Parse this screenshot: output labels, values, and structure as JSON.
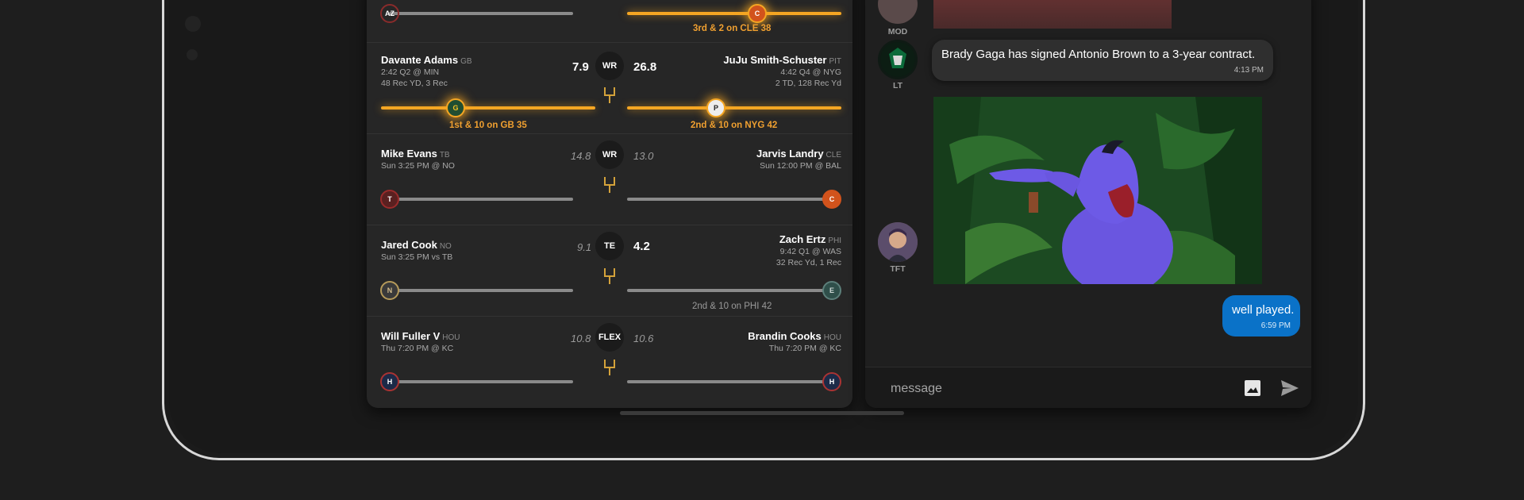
{
  "matchups": [
    {
      "left": {
        "name": "",
        "team": "",
        "meta1": "",
        "meta2": "",
        "points": "",
        "team_icon": "cardinals-helmet-icon"
      },
      "position": "",
      "right": {
        "name": "",
        "team": "",
        "meta1": "",
        "meta2": "",
        "points": "",
        "team_icon": "browns-helmet-icon"
      },
      "right_status": "3rd & 2 on CLE 38",
      "left_progress": 0.05,
      "right_progress": 0.6
    },
    {
      "left": {
        "name": "Davante Adams",
        "team": "GB",
        "meta1": "2:42 Q2 @ MIN",
        "meta2": "48 Rec YD, 3 Rec",
        "points": "7.9",
        "team_icon": "packers-helmet-icon"
      },
      "position": "WR",
      "right": {
        "name": "JuJu Smith-Schuster",
        "team": "PIT",
        "meta1": "4:42 Q4 @ NYG",
        "meta2": "2 TD, 128 Rec Yd",
        "points": "26.8",
        "team_icon": "steelers-helmet-icon"
      },
      "left_status": "1st & 10 on GB 35",
      "right_status": "2nd & 10 on NYG 42"
    },
    {
      "left": {
        "name": "Mike Evans",
        "team": "TB",
        "meta1": "Sun 3:25 PM @ NO",
        "points": "14.8",
        "team_icon": "buccaneers-helmet-icon"
      },
      "position": "WR",
      "right": {
        "name": "Jarvis Landry",
        "team": "CLE",
        "meta1": "Sun 12:00 PM @ BAL",
        "points": "13.0",
        "team_icon": "browns-helmet-icon"
      }
    },
    {
      "left": {
        "name": "Jared Cook",
        "team": "NO",
        "meta1": "Sun 3:25 PM vs TB",
        "points": "9.1",
        "team_icon": "saints-helmet-icon"
      },
      "position": "TE",
      "right": {
        "name": "Zach Ertz",
        "team": "PHI",
        "meta1": "9:42 Q1 @ WAS",
        "meta2": "32 Rec Yd, 1 Rec",
        "points": "4.2",
        "team_icon": "eagles-helmet-icon"
      },
      "center_status": "2nd & 10 on PHI 42"
    },
    {
      "left": {
        "name": "Will Fuller V",
        "team": "HOU",
        "meta1": "Thu 7:20 PM @ KC",
        "points": "10.8",
        "team_icon": "texans-helmet-icon"
      },
      "position": "FLEX",
      "right": {
        "name": "Brandin Cooks",
        "team": "HOU",
        "meta1": "Thu 7:20 PM @ KC",
        "points": "10.6",
        "team_icon": "texans-helmet-icon"
      }
    }
  ],
  "chat": {
    "messages": [
      {
        "author": "MOD",
        "type": "image"
      },
      {
        "author": "LT",
        "text": "Brady Gaga has signed Antonio Brown to a 3-year contract.",
        "time": "4:13 PM"
      },
      {
        "author": "TFT",
        "type": "gif",
        "gif_subject": "genie-pointing-gif"
      },
      {
        "author": "me",
        "text": "well played.",
        "time": "6:59 PM"
      }
    ],
    "composer": {
      "placeholder": "message",
      "image_icon": "image-icon",
      "send_icon": "send-icon"
    }
  },
  "colors": {
    "accent_live": "#f5a623",
    "outgoing_bubble": "#0a72c8",
    "panel": "#262626",
    "background": "#1e1e1e"
  }
}
